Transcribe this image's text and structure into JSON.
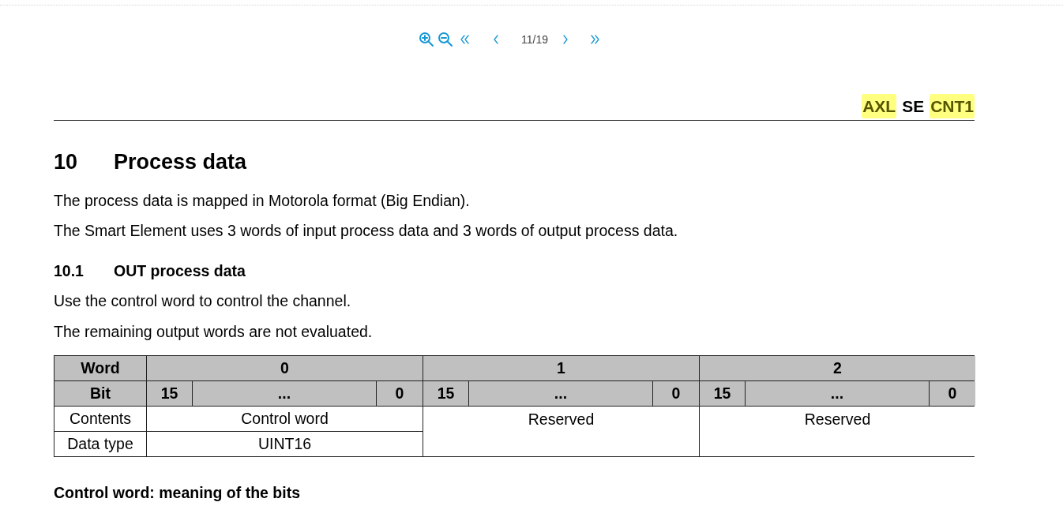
{
  "toolbar": {
    "page_indicator": "11/19"
  },
  "page": {
    "header": [
      {
        "text": "AXL",
        "highlighted": true
      },
      {
        "text": "SE",
        "highlighted": false
      },
      {
        "text": "CNT1",
        "highlighted": true
      }
    ],
    "section": {
      "number": "10",
      "title": "Process data"
    },
    "paragraphs": [
      "The process data is mapped in Motorola format (Big Endian).",
      "The Smart Element uses 3 words of input process data and 3 words of output process data."
    ],
    "subsection": {
      "number": "10.1",
      "title": "OUT process data"
    },
    "sub_paragraphs": [
      "Use the control word to control the channel.",
      "The remaining output words are not evaluated."
    ],
    "table": {
      "word_label": "Word",
      "bit_label": "Bit",
      "contents_label": "Contents",
      "data_type_label": "Data type",
      "words": [
        {
          "number": "0",
          "bits": [
            "15",
            "...",
            "0"
          ],
          "contents": "Control word",
          "data_type": "UINT16"
        },
        {
          "number": "1",
          "bits": [
            "15",
            "...",
            "0"
          ],
          "contents": "Reserved"
        },
        {
          "number": "2",
          "bits": [
            "15",
            "...",
            "0"
          ],
          "contents": "Reserved"
        }
      ]
    },
    "next_heading": "Control word: meaning of the bits"
  }
}
